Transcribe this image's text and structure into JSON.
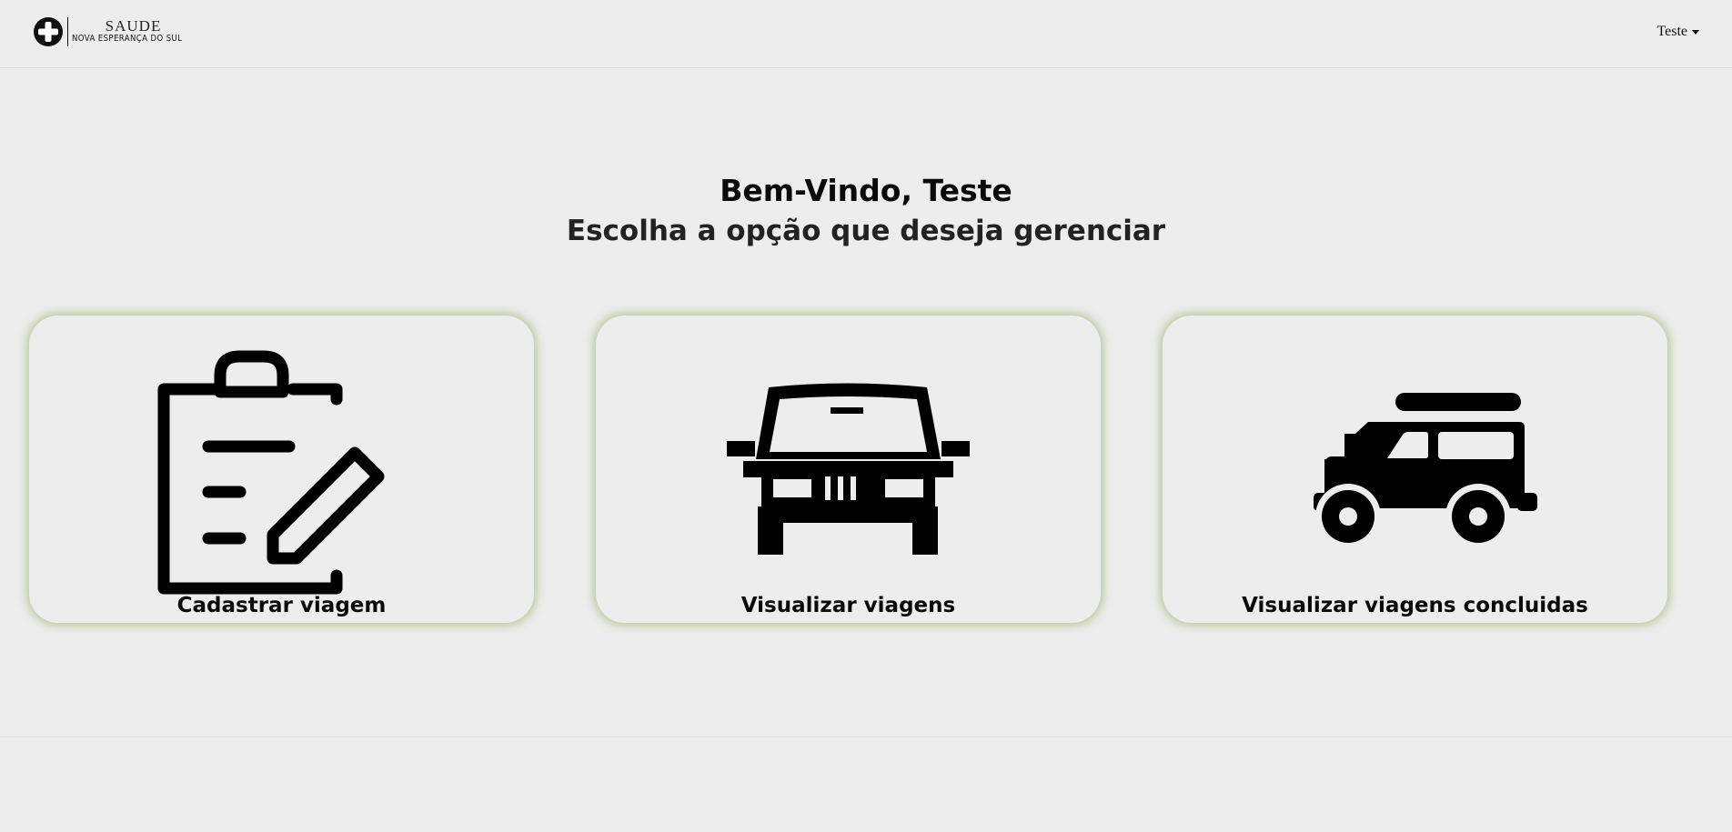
{
  "brand": {
    "line1": "SAUDE",
    "line2": "NOVA ESPERANÇA DO SUL",
    "logo_icon": "medical-cross-icon"
  },
  "user_menu": {
    "label": "Teste",
    "icon": "caret-down-icon"
  },
  "welcome": {
    "title": "Bem-Vindo, Teste",
    "subtitle": "Escolha a opção que deseja gerenciar"
  },
  "cards": [
    {
      "label": "Cadastrar viagem",
      "icon": "clipboard-edit-icon"
    },
    {
      "label": "Visualizar viagens",
      "icon": "car-front-icon"
    },
    {
      "label": "Visualizar viagens concluidas",
      "icon": "suv-side-icon"
    }
  ],
  "colors": {
    "background": "#ededed",
    "card_glow": "#a0b46e",
    "icon": "#000000"
  }
}
